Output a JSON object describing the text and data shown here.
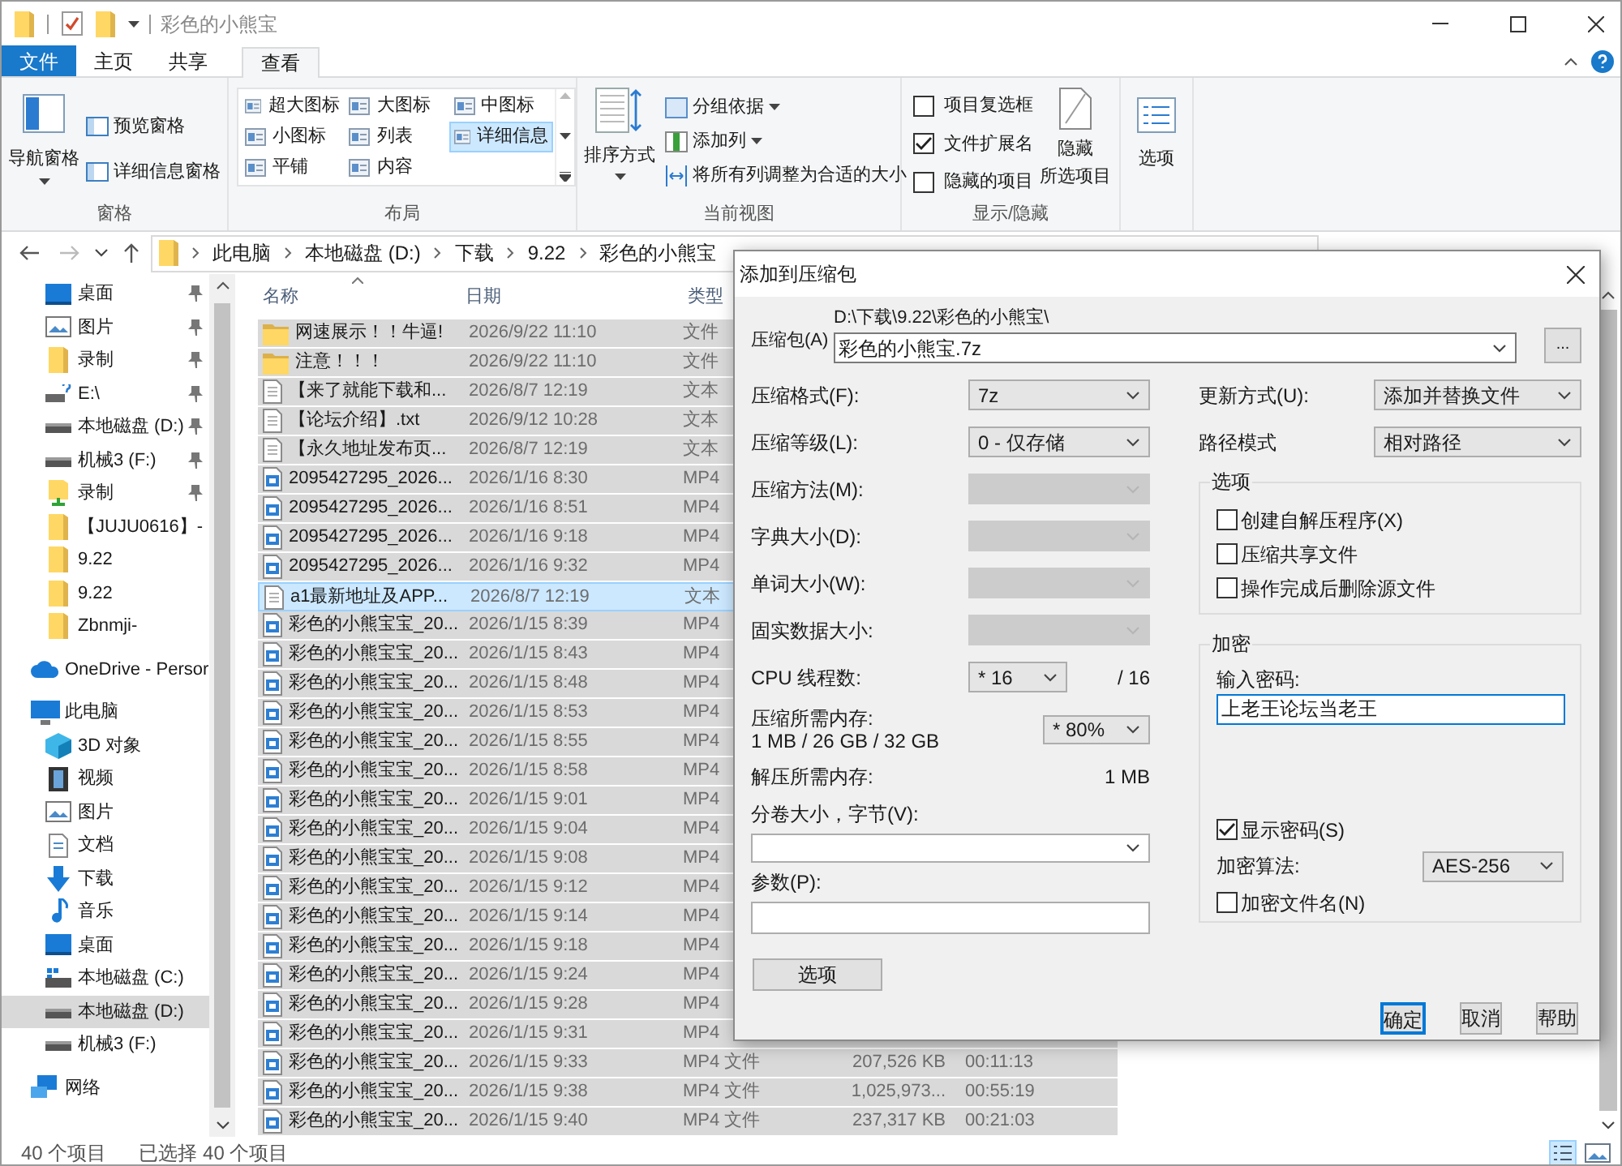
{
  "window": {
    "title": "彩色的小熊宝"
  },
  "ribbon_tabs": [
    {
      "label": "文件",
      "kind": "file",
      "selected": false
    },
    {
      "label": "主页",
      "kind": "tab",
      "selected": false
    },
    {
      "label": "共享",
      "kind": "tab",
      "selected": false
    },
    {
      "label": "查看",
      "kind": "tab",
      "selected": true
    }
  ],
  "ribbon": {
    "panes": {
      "label": "窗格",
      "nav_pane": "导航窗格",
      "preview_pane": "预览窗格",
      "details_pane": "详细信息窗格"
    },
    "layout": {
      "label": "布局",
      "options": [
        {
          "label": "超大图标",
          "selected": false
        },
        {
          "label": "大图标",
          "selected": false
        },
        {
          "label": "中图标",
          "selected": false
        },
        {
          "label": "小图标",
          "selected": false
        },
        {
          "label": "列表",
          "selected": false
        },
        {
          "label": "详细信息",
          "selected": true
        },
        {
          "label": "平铺",
          "selected": false
        },
        {
          "label": "内容",
          "selected": false
        }
      ]
    },
    "current_view": {
      "label": "当前视图",
      "sort_by": "排序方式",
      "group_by": "分组依据",
      "add_column": "添加列",
      "fit_columns": "将所有列调整为合适的大小"
    },
    "show_hide": {
      "label": "显示/隐藏",
      "checkboxes": [
        {
          "label": "项目复选框",
          "checked": false
        },
        {
          "label": "文件扩展名",
          "checked": true
        },
        {
          "label": "隐藏的项目",
          "checked": false
        }
      ],
      "hide_selected": [
        "隐藏",
        "所选项目"
      ]
    },
    "options": "选项"
  },
  "address": {
    "crumbs": [
      "此电脑",
      "本地磁盘 (D:)",
      "下载",
      "9.22",
      "彩色的小熊宝"
    ]
  },
  "nav_sections": [
    {
      "children": [
        {
          "kind": "desktop",
          "label": "桌面",
          "pinned": true,
          "selected": false
        },
        {
          "kind": "pictures",
          "label": "图片",
          "pinned": true,
          "selected": false
        },
        {
          "kind": "folder",
          "label": "录制",
          "pinned": true,
          "selected": false
        },
        {
          "kind": "netdrive",
          "label": "E:\\",
          "pinned": true,
          "selected": false
        },
        {
          "kind": "drive",
          "label": "本地磁盘 (D:)",
          "pinned": true,
          "selected": false
        },
        {
          "kind": "drive",
          "label": "机械3 (F:)",
          "pinned": true,
          "selected": false
        },
        {
          "kind": "recording",
          "label": "录制",
          "pinned": true,
          "selected": false
        },
        {
          "kind": "folder",
          "label": "【JUJU0616】-",
          "pinned": false,
          "selected": false
        },
        {
          "kind": "folder",
          "label": "9.22",
          "pinned": false,
          "selected": false
        },
        {
          "kind": "folder",
          "label": "9.22",
          "pinned": false,
          "selected": false
        },
        {
          "kind": "folder",
          "label": "Zbnmji-",
          "pinned": false,
          "selected": false
        }
      ]
    },
    {
      "kind": "cloud",
      "label": "OneDrive - Persor",
      "selected": false
    },
    {
      "kind": "pc",
      "label": "此电脑",
      "selected": false,
      "children": [
        {
          "kind": "cube",
          "label": "3D 对象",
          "selected": false
        },
        {
          "kind": "video",
          "label": "视频",
          "selected": false
        },
        {
          "kind": "pictures",
          "label": "图片",
          "selected": false
        },
        {
          "kind": "document",
          "label": "文档",
          "selected": false
        },
        {
          "kind": "download",
          "label": "下载",
          "selected": false
        },
        {
          "kind": "music",
          "label": "音乐",
          "selected": false
        },
        {
          "kind": "desktop",
          "label": "桌面",
          "selected": false
        },
        {
          "kind": "sysdrive",
          "label": "本地磁盘 (C:)",
          "selected": false
        },
        {
          "kind": "drive",
          "label": "本地磁盘 (D:)",
          "selected": true
        },
        {
          "kind": "drive",
          "label": "机械3 (F:)",
          "selected": false
        }
      ]
    },
    {
      "kind": "network",
      "label": "网络",
      "selected": false
    }
  ],
  "file_list": {
    "columns": [
      {
        "label": "名称"
      },
      {
        "label": "日期"
      },
      {
        "label": "类型"
      }
    ],
    "rows": [
      {
        "kind": "folder",
        "name": "网速展示！！牛逼!",
        "date": "2026/9/22 11:10",
        "type": "文件",
        "selected": true,
        "focused": false
      },
      {
        "kind": "folder",
        "name": "注意！！！",
        "date": "2026/9/22 11:10",
        "type": "文件",
        "selected": true,
        "focused": false
      },
      {
        "kind": "text",
        "name": "【来了就能下载和...",
        "date": "2026/8/7 12:19",
        "type": "文本",
        "selected": true,
        "focused": false
      },
      {
        "kind": "text",
        "name": "【论坛介绍】.txt",
        "date": "2026/9/12 10:28",
        "type": "文本",
        "selected": true,
        "focused": false
      },
      {
        "kind": "text",
        "name": "【永久地址发布页...",
        "date": "2026/8/7 12:19",
        "type": "文本",
        "selected": true,
        "focused": false
      },
      {
        "kind": "video",
        "name": "2095427295_2026...",
        "date": "2026/1/16 8:30",
        "type": "MP4",
        "selected": true,
        "focused": false
      },
      {
        "kind": "video",
        "name": "2095427295_2026...",
        "date": "2026/1/16 8:51",
        "type": "MP4",
        "selected": true,
        "focused": false
      },
      {
        "kind": "video",
        "name": "2095427295_2026...",
        "date": "2026/1/16 9:18",
        "type": "MP4",
        "selected": true,
        "focused": false
      },
      {
        "kind": "video",
        "name": "2095427295_2026...",
        "date": "2026/1/16 9:32",
        "type": "MP4",
        "selected": true,
        "focused": false
      },
      {
        "kind": "text",
        "name": "a1最新地址及APP...",
        "date": "2026/8/7 12:19",
        "type": "文本",
        "selected": true,
        "focused": true
      },
      {
        "kind": "video",
        "name": "彩色的小熊宝宝_20...",
        "date": "2026/1/15 8:39",
        "type": "MP4",
        "selected": true,
        "focused": false
      },
      {
        "kind": "video",
        "name": "彩色的小熊宝宝_20...",
        "date": "2026/1/15 8:43",
        "type": "MP4",
        "selected": true,
        "focused": false
      },
      {
        "kind": "video",
        "name": "彩色的小熊宝宝_20...",
        "date": "2026/1/15 8:48",
        "type": "MP4",
        "selected": true,
        "focused": false
      },
      {
        "kind": "video",
        "name": "彩色的小熊宝宝_20...",
        "date": "2026/1/15 8:53",
        "type": "MP4",
        "selected": true,
        "focused": false
      },
      {
        "kind": "video",
        "name": "彩色的小熊宝宝_20...",
        "date": "2026/1/15 8:55",
        "type": "MP4",
        "selected": true,
        "focused": false
      },
      {
        "kind": "video",
        "name": "彩色的小熊宝宝_20...",
        "date": "2026/1/15 8:58",
        "type": "MP4",
        "selected": true,
        "focused": false
      },
      {
        "kind": "video",
        "name": "彩色的小熊宝宝_20...",
        "date": "2026/1/15 9:01",
        "type": "MP4",
        "selected": true,
        "focused": false
      },
      {
        "kind": "video",
        "name": "彩色的小熊宝宝_20...",
        "date": "2026/1/15 9:04",
        "type": "MP4",
        "selected": true,
        "focused": false
      },
      {
        "kind": "video",
        "name": "彩色的小熊宝宝_20...",
        "date": "2026/1/15 9:08",
        "type": "MP4",
        "selected": true,
        "focused": false
      },
      {
        "kind": "video",
        "name": "彩色的小熊宝宝_20...",
        "date": "2026/1/15 9:12",
        "type": "MP4",
        "selected": true,
        "focused": false
      },
      {
        "kind": "video",
        "name": "彩色的小熊宝宝_20...",
        "date": "2026/1/15 9:14",
        "type": "MP4",
        "selected": true,
        "focused": false
      },
      {
        "kind": "video",
        "name": "彩色的小熊宝宝_20...",
        "date": "2026/1/15 9:18",
        "type": "MP4",
        "selected": true,
        "focused": false
      },
      {
        "kind": "video",
        "name": "彩色的小熊宝宝_20...",
        "date": "2026/1/15 9:24",
        "type": "MP4",
        "selected": true,
        "focused": false
      },
      {
        "kind": "video",
        "name": "彩色的小熊宝宝_20...",
        "date": "2026/1/15 9:28",
        "type": "MP4",
        "selected": true,
        "focused": false
      },
      {
        "kind": "video",
        "name": "彩色的小熊宝宝_20...",
        "date": "2026/1/15 9:31",
        "type": "MP4",
        "selected": true,
        "focused": false
      },
      {
        "kind": "video",
        "name": "彩色的小熊宝宝_20...",
        "date": "2026/1/15 9:33",
        "type": "MP4 文件",
        "size": "207,526 KB",
        "duration": "00:11:13",
        "selected": true,
        "focused": false
      },
      {
        "kind": "video",
        "name": "彩色的小熊宝宝_20...",
        "date": "2026/1/15 9:38",
        "type": "MP4 文件",
        "size": "1,025,973...",
        "duration": "00:55:19",
        "selected": true,
        "focused": false
      },
      {
        "kind": "video",
        "name": "彩色的小熊宝宝_20...",
        "date": "2026/1/15 9:40",
        "type": "MP4 文件",
        "size": "237,317 KB",
        "duration": "00:21:03",
        "selected": true,
        "focused": false
      }
    ]
  },
  "status_bar": {
    "item_count": "40 个项目",
    "selected_count": "已选择 40 个项目"
  },
  "dialog": {
    "title": "添加到压缩包",
    "archive_label": "压缩包(A)",
    "archive_path": "D:\\下载\\9.22\\彩色的小熊宝\\",
    "archive_name": "彩色的小熊宝.7z",
    "browse": "...",
    "left_fields": [
      {
        "label": "压缩格式(F):",
        "value": "7z",
        "disabled": false
      },
      {
        "label": "压缩等级(L):",
        "value": "0 - 仅存储",
        "disabled": false
      },
      {
        "label": "压缩方法(M):",
        "disabled": true
      },
      {
        "label": "字典大小(D):",
        "disabled": true
      },
      {
        "label": "单词大小(W):",
        "disabled": true
      },
      {
        "label": "固实数据大小:",
        "disabled": true
      }
    ],
    "cpu": {
      "label": "CPU 线程数:",
      "value": "* 16",
      "total": "/ 16"
    },
    "memory": {
      "label": "压缩所需内存:",
      "detail": "1 MB / 26 GB / 32 GB",
      "value": "* 80%"
    },
    "decompress": {
      "label": "解压所需内存:",
      "value": "1 MB"
    },
    "volume_label": "分卷大小，字节(V):",
    "params_label": "参数(P):",
    "options_button": "选项",
    "update": {
      "label": "更新方式(U):",
      "value": "添加并替换文件"
    },
    "path_mode": {
      "label": "路径模式",
      "value": "相对路径"
    },
    "options_group": {
      "title": "选项",
      "checkboxes": [
        {
          "label": "创建自解压程序(X)",
          "checked": false
        },
        {
          "label": "压缩共享文件",
          "checked": false
        },
        {
          "label": "操作完成后删除源文件",
          "checked": false
        }
      ]
    },
    "encryption": {
      "title": "加密",
      "password_label": "输入密码:",
      "password": "上老王论坛当老王",
      "show_password": {
        "label": "显示密码(S)",
        "checked": true
      },
      "method_label": "加密算法:",
      "method": "AES-256",
      "encrypt_names": {
        "label": "加密文件名(N)",
        "checked": false
      }
    },
    "buttons": [
      {
        "label": "确定",
        "default": true
      },
      {
        "label": "取消",
        "default": false
      },
      {
        "label": "帮助",
        "default": false
      }
    ]
  }
}
